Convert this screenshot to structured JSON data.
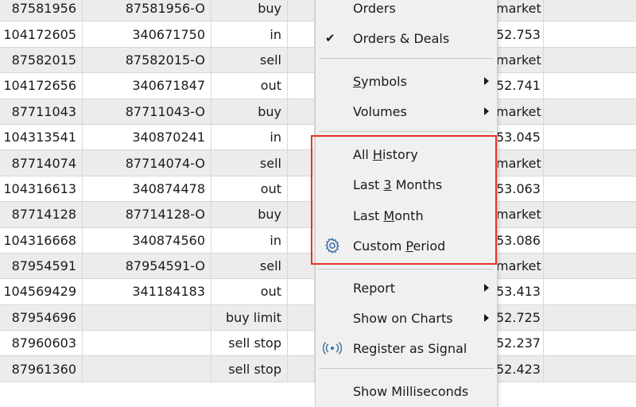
{
  "table": {
    "rows": [
      {
        "id": "87581956",
        "order": "87581956-O",
        "type": "buy",
        "price": "market"
      },
      {
        "id": "104172605",
        "order": "340671750",
        "type": "in",
        "price": "52.753"
      },
      {
        "id": "87582015",
        "order": "87582015-O",
        "type": "sell",
        "price": "market"
      },
      {
        "id": "104172656",
        "order": "340671847",
        "type": "out",
        "price": "52.741"
      },
      {
        "id": "87711043",
        "order": "87711043-O",
        "type": "buy",
        "price": "market"
      },
      {
        "id": "104313541",
        "order": "340870241",
        "type": "in",
        "price": "53.045"
      },
      {
        "id": "87714074",
        "order": "87714074-O",
        "type": "sell",
        "price": "market"
      },
      {
        "id": "104316613",
        "order": "340874478",
        "type": "out",
        "price": "53.063"
      },
      {
        "id": "87714128",
        "order": "87714128-O",
        "type": "buy",
        "price": "market"
      },
      {
        "id": "104316668",
        "order": "340874560",
        "type": "in",
        "price": "53.086"
      },
      {
        "id": "87954591",
        "order": "87954591-O",
        "type": "sell",
        "price": "market"
      },
      {
        "id": "104569429",
        "order": "341184183",
        "type": "out",
        "price": "53.413"
      },
      {
        "id": "87954696",
        "order": "",
        "type": "buy limit",
        "price": "52.725"
      },
      {
        "id": "87960603",
        "order": "",
        "type": "sell stop",
        "price": "52.237"
      },
      {
        "id": "87961360",
        "order": "",
        "type": "sell stop",
        "price": "52.423"
      }
    ]
  },
  "menu": {
    "orders": {
      "pre": "Orders",
      "ul": "",
      "post": ""
    },
    "orders_deals": {
      "pre": "Orders & Deals",
      "ul": "",
      "post": ""
    },
    "orders_deals_check": "✔",
    "symbols": {
      "pre": "",
      "ul": "S",
      "post": "ymbols"
    },
    "volumes": {
      "pre": "Volumes",
      "ul": "",
      "post": ""
    },
    "all_history": {
      "pre": "All ",
      "ul": "H",
      "post": "istory"
    },
    "last_3_months": {
      "pre": "Last ",
      "ul": "3",
      "post": " Months"
    },
    "last_month": {
      "pre": "Last ",
      "ul": "M",
      "post": "onth"
    },
    "custom_period": {
      "pre": "Custom ",
      "ul": "P",
      "post": "eriod"
    },
    "report": {
      "pre": "Report",
      "ul": "",
      "post": ""
    },
    "show_on_charts": {
      "pre": "Show on Charts",
      "ul": "",
      "post": ""
    },
    "register_signal": {
      "pre": "Register as Signal",
      "ul": "",
      "post": ""
    },
    "show_milliseconds": {
      "pre": "Show Milliseconds",
      "ul": "",
      "post": ""
    }
  },
  "colors": {
    "highlight": "#e5322b",
    "menu_bg": "#f0f0f0",
    "row_shade": "#ececec",
    "icon_blue": "#3a6ea5"
  },
  "icons": {
    "checkmark": "checkmark-icon",
    "submenu": "chevron-right-icon",
    "custom_period": "gear-icon",
    "signal": "broadcast-icon"
  }
}
